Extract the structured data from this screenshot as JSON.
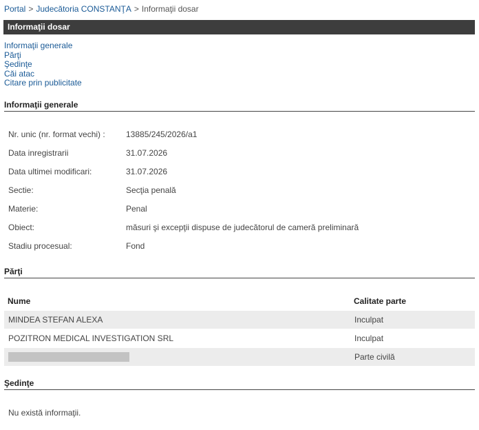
{
  "breadcrumb": {
    "portal": "Portal",
    "sep1": ">",
    "court": "Judecătoria CONSTANŢA",
    "sep2": ">",
    "current": "Informaţii dosar"
  },
  "title": "Informaţii dosar",
  "toc": [
    "Informaţii generale",
    "Părţi",
    "Şedinţe",
    "Căi atac",
    "Citare prin publicitate"
  ],
  "general": {
    "heading": "Informaţii generale",
    "rows": [
      {
        "label": "Nr. unic (nr. format vechi) :",
        "value": "13885/245/2026/a1"
      },
      {
        "label": "Data inregistrarii",
        "value": "31.07.2026"
      },
      {
        "label": "Data ultimei modificari:",
        "value": "31.07.2026"
      },
      {
        "label": "Sectie:",
        "value": "Secţia penală"
      },
      {
        "label": "Materie:",
        "value": "Penal"
      },
      {
        "label": "Obiect:",
        "value": "măsuri şi excepţii dispuse de judecătorul de cameră preliminară"
      },
      {
        "label": "Stadiu procesual:",
        "value": "Fond"
      }
    ]
  },
  "parti": {
    "heading": "Părţi",
    "col_name": "Nume",
    "col_role": "Calitate parte",
    "rows": [
      {
        "name": "MINDEA STEFAN ALEXA",
        "role": "Inculpat"
      },
      {
        "name": "POZITRON MEDICAL INVESTIGATION SRL",
        "role": "Inculpat"
      },
      {
        "name": "",
        "role": "Parte civilă"
      }
    ]
  },
  "sedinte": {
    "heading": "Şedinţe",
    "empty": "Nu există informaţii."
  }
}
